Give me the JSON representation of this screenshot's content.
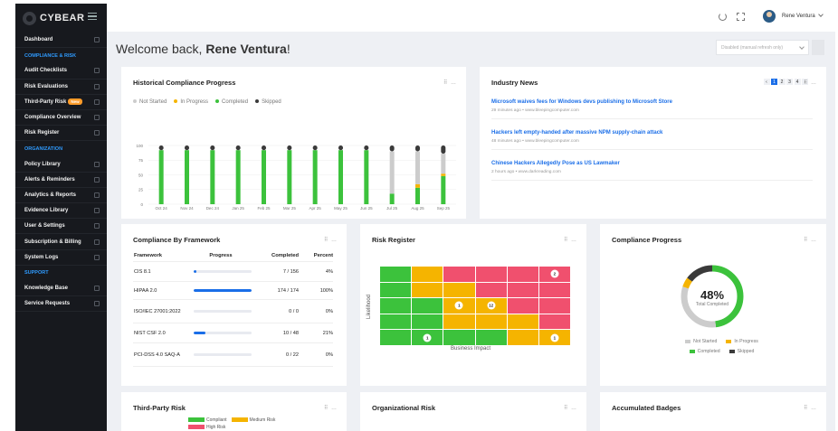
{
  "brand": {
    "name": "CYBEAR"
  },
  "sidebar": {
    "items": [
      {
        "type": "item",
        "label": "Dashboard"
      },
      {
        "type": "section",
        "label": "COMPLIANCE & RISK"
      },
      {
        "type": "item",
        "label": "Audit Checklists"
      },
      {
        "type": "item",
        "label": "Risk Evaluations"
      },
      {
        "type": "item",
        "label": "Third-Party Risk",
        "badge": "New"
      },
      {
        "type": "item",
        "label": "Compliance Overview"
      },
      {
        "type": "item",
        "label": "Risk Register"
      },
      {
        "type": "section",
        "label": "ORGANIZATION"
      },
      {
        "type": "item",
        "label": "Policy Library"
      },
      {
        "type": "item",
        "label": "Alerts & Reminders"
      },
      {
        "type": "item",
        "label": "Analytics & Reports"
      },
      {
        "type": "item",
        "label": "Evidence Library"
      },
      {
        "type": "item",
        "label": "User & Settings"
      },
      {
        "type": "item",
        "label": "Subscription & Billing"
      },
      {
        "type": "item",
        "label": "System Logs"
      },
      {
        "type": "section",
        "label": "SUPPORT"
      },
      {
        "type": "item",
        "label": "Knowledge Base"
      },
      {
        "type": "item",
        "label": "Service Requests"
      }
    ]
  },
  "topbar": {
    "user_name": "Rene Ventura"
  },
  "welcome": {
    "prefix": "Welcome back, ",
    "name": "Rene Ventura",
    "suffix": "!"
  },
  "refresh_select": {
    "value": "Disabled (manual refresh only)"
  },
  "colors": {
    "not_started": "#cccccc",
    "in_progress": "#f5b400",
    "completed": "#3cc23c",
    "skipped": "#3a3a3a",
    "accent": "#1a6ee8",
    "sidebar": "#17191e",
    "risk_green": "#3cc23c",
    "risk_yellow": "#f5b400",
    "risk_red": "#f0506e"
  },
  "historical": {
    "title": "Historical Compliance Progress",
    "legend": [
      "Not Started",
      "In Progress",
      "Completed",
      "Skipped"
    ]
  },
  "chart_data": {
    "type": "bar",
    "title": "Historical Compliance Progress",
    "categories": [
      "Oct 24",
      "Nov 24",
      "Dec 24",
      "Jan 25",
      "Feb 25",
      "Mar 25",
      "Apr 25",
      "May 25",
      "Jun 25",
      "Jul 25",
      "Aug 25",
      "Sep 25"
    ],
    "yticks": [
      0,
      25,
      50,
      75,
      100
    ],
    "ylim": [
      0,
      100
    ],
    "stacked": true,
    "series": [
      {
        "name": "Completed",
        "values": [
          92,
          92,
          92,
          92,
          92,
          92,
          92,
          92,
          92,
          18,
          28,
          48
        ]
      },
      {
        "name": "In Progress",
        "values": [
          0,
          0,
          0,
          0,
          0,
          0,
          0,
          0,
          0,
          0,
          6,
          4
        ]
      },
      {
        "name": "Not Started",
        "values": [
          0,
          0,
          0,
          0,
          0,
          0,
          0,
          0,
          0,
          72,
          56,
          34
        ]
      },
      {
        "name": "Skipped",
        "values": [
          8,
          8,
          8,
          8,
          8,
          8,
          8,
          8,
          8,
          10,
          10,
          14
        ]
      }
    ]
  },
  "news": {
    "title": "Industry News",
    "pages": [
      "‹",
      "1",
      "2",
      "3",
      "4",
      "›"
    ],
    "items": [
      {
        "title": "Microsoft waives fees for Windows devs publishing to Microsoft Store",
        "meta": "29 minutes ago • www.bleepingcomputer.com"
      },
      {
        "title": "Hackers left empty-handed after massive NPM supply-chain attack",
        "meta": "48 minutes ago • www.bleepingcomputer.com"
      },
      {
        "title": "Chinese Hackers Allegedly Pose as US Lawmaker",
        "meta": "2 hours ago • www.darkreading.com"
      }
    ]
  },
  "frameworks": {
    "title": "Compliance By Framework",
    "headers": [
      "Framework",
      "Progress",
      "Completed",
      "Percent"
    ],
    "rows": [
      {
        "name": "CIS 8.1",
        "progress": 0.04,
        "completed": "7 / 156",
        "percent": "4%"
      },
      {
        "name": "HIPAA 2.0",
        "progress": 1.0,
        "completed": "174 / 174",
        "percent": "100%"
      },
      {
        "name": "ISO/IEC 27001:2022",
        "progress": 0,
        "completed": "0 / 0",
        "percent": "0%"
      },
      {
        "name": "NIST CSF 2.0",
        "progress": 0.21,
        "completed": "10 / 48",
        "percent": "21%"
      },
      {
        "name": "PCI-DSS 4.0 SAQ-A",
        "progress": 0,
        "completed": "0 / 22",
        "percent": "0%"
      }
    ]
  },
  "risk_register": {
    "title": "Risk Register",
    "ylabel": "Likelihood",
    "xlabel": "Business Impact",
    "grid": [
      [
        "green",
        "yellow",
        "red",
        "red",
        "red",
        "red"
      ],
      [
        "green",
        "yellow",
        "yellow",
        "red",
        "red",
        "red"
      ],
      [
        "green",
        "green",
        "yellow",
        "yellow",
        "red",
        "red"
      ],
      [
        "green",
        "green",
        "yellow",
        "yellow",
        "yellow",
        "red"
      ],
      [
        "green",
        "green",
        "green",
        "green",
        "yellow",
        "yellow"
      ]
    ],
    "markers": [
      {
        "row": 0,
        "col": 5,
        "label": "2"
      },
      {
        "row": 2,
        "col": 2,
        "label": "1"
      },
      {
        "row": 2,
        "col": 3,
        "label": "12"
      },
      {
        "row": 4,
        "col": 1,
        "label": "1"
      },
      {
        "row": 4,
        "col": 5,
        "label": "1"
      }
    ]
  },
  "compliance_progress": {
    "title": "Compliance Progress",
    "percent": "48%",
    "subtitle": "Total Completed",
    "legend": [
      "Not Started",
      "In Progress",
      "Completed",
      "Skipped"
    ],
    "segments": [
      {
        "name": "Completed",
        "value": 0.48
      },
      {
        "name": "Not Started",
        "value": 0.32
      },
      {
        "name": "In Progress",
        "value": 0.05
      },
      {
        "name": "Skipped",
        "value": 0.15
      }
    ]
  },
  "third_party": {
    "title": "Third-Party Risk",
    "legend": [
      "Compliant",
      "Medium Risk",
      "High Risk"
    ]
  },
  "org_risk": {
    "title": "Organizational Risk"
  },
  "badges": {
    "title": "Accumulated Badges"
  }
}
